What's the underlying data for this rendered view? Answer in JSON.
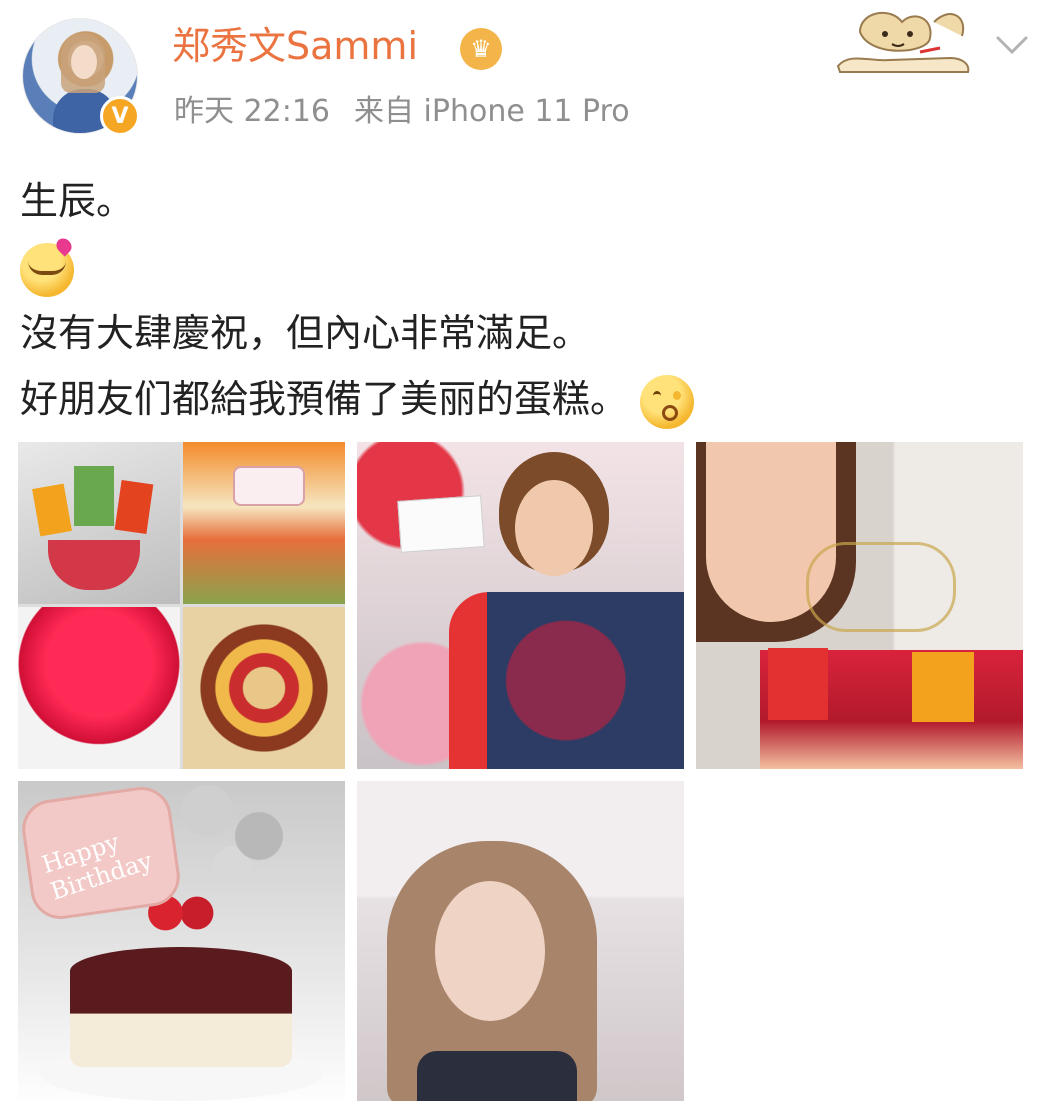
{
  "user": {
    "name": "郑秀文Sammi",
    "time": "昨天 22:16",
    "source": "来自 iPhone 11 Pro"
  },
  "post": {
    "line1": "生辰。",
    "line3": "沒有大肆慶祝，但內心非常滿足。",
    "line4": "好朋友们都給我預備了美丽的蛋糕。"
  },
  "icons": [
    "verified-v-icon",
    "crown-icon",
    "dog-decoration-icon",
    "chevron-down-icon",
    "hugging-face-emoji",
    "kissing-face-emoji"
  ],
  "images": [
    {
      "name": "cake-collage"
    },
    {
      "name": "flowers-selfie"
    },
    {
      "name": "snacks-cake-selfie"
    },
    {
      "name": "chocolate-birthday-cake"
    },
    {
      "name": "portrait-selfie"
    }
  ],
  "colors": {
    "username": "#eb7340",
    "meta": "#8f8f8f",
    "verified": "#f5a623"
  }
}
